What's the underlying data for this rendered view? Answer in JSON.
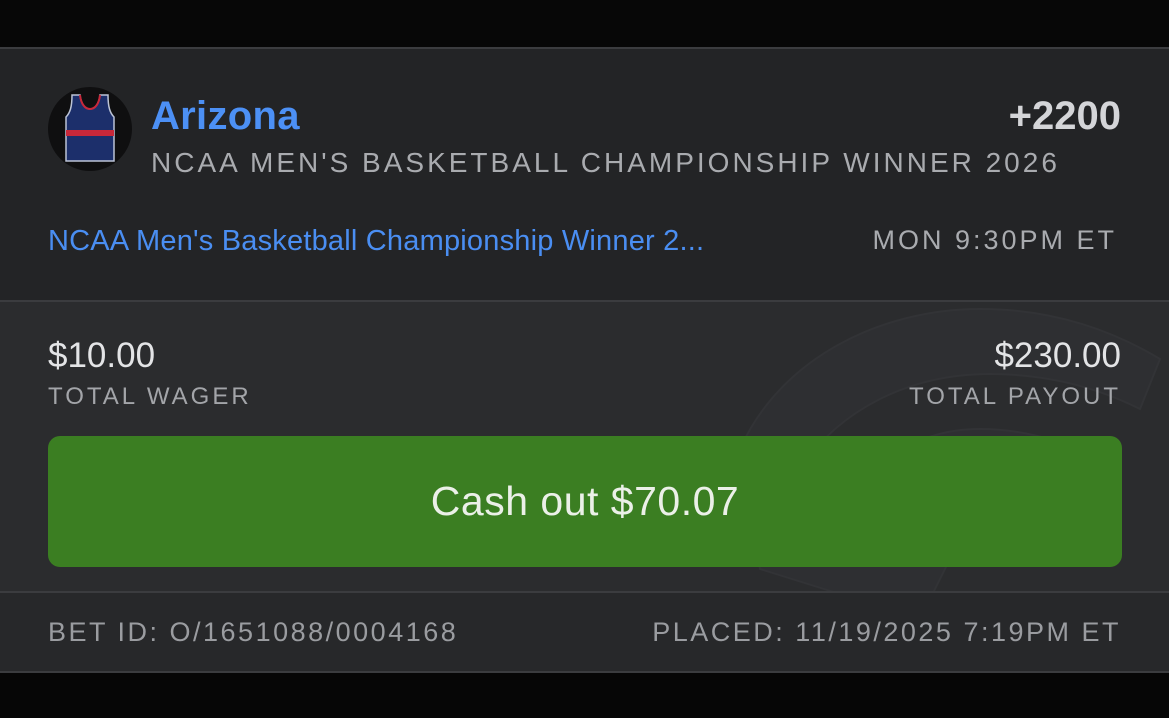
{
  "bet": {
    "team_name": "Arizona",
    "odds": "+2200",
    "market": "NCAA MEN'S BASKETBALL CHAMPIONSHIP WINNER 2026",
    "event_link": "NCAA Men's Basketball Championship Winner 2...",
    "event_time": "MON 9:30PM ET",
    "team_icon": "basketball-jersey-icon"
  },
  "wager": {
    "total_wager_amount": "$10.00",
    "total_wager_label": "TOTAL WAGER",
    "total_payout_amount": "$230.00",
    "total_payout_label": "TOTAL PAYOUT"
  },
  "cashout": {
    "label": "Cash out $70.07"
  },
  "footer": {
    "bet_id": "BET ID: O/1651088/0004168",
    "placed": "PLACED: 11/19/2025 7:19PM ET"
  },
  "colors": {
    "link_blue": "#4a8ef2",
    "cashout_green": "#3b7e22",
    "card_bg": "#2b2c2e",
    "header_bg": "#232426",
    "jersey_navy": "#1c2f6b",
    "jersey_red": "#c8283a"
  }
}
